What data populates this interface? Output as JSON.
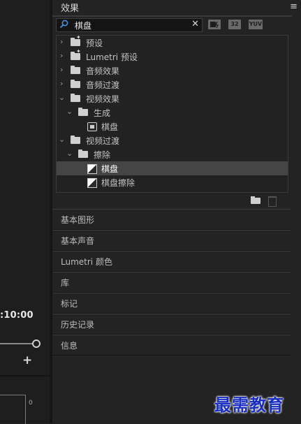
{
  "timeline": {
    "timecode": ":10:00",
    "add_label": "+",
    "meter_zero": "0"
  },
  "effects_panel": {
    "title": "效果",
    "menu_glyph": "≡",
    "search": {
      "value": "棋盘",
      "clear_glyph": "✕"
    },
    "filter_badges": [
      "32",
      "YUV"
    ],
    "tree": [
      {
        "label": "预设",
        "expanded": false,
        "depth": 0,
        "icon": "folder-star-icon"
      },
      {
        "label": "Lumetri 预设",
        "expanded": false,
        "depth": 0,
        "icon": "folder-star-icon"
      },
      {
        "label": "音频效果",
        "expanded": false,
        "depth": 0,
        "icon": "folder-icon"
      },
      {
        "label": "音频过渡",
        "expanded": false,
        "depth": 0,
        "icon": "folder-icon"
      },
      {
        "label": "视频效果",
        "expanded": true,
        "depth": 0,
        "icon": "folder-icon"
      },
      {
        "label": "生成",
        "expanded": true,
        "depth": 1,
        "icon": "folder-icon"
      },
      {
        "label": "棋盘",
        "depth": 2,
        "icon": "video-effect-icon"
      },
      {
        "label": "视频过渡",
        "expanded": true,
        "depth": 0,
        "icon": "folder-icon"
      },
      {
        "label": "擦除",
        "expanded": true,
        "depth": 1,
        "icon": "folder-icon"
      },
      {
        "label": "棋盘",
        "depth": 2,
        "icon": "transition-icon",
        "selected": true
      },
      {
        "label": "棋盘擦除",
        "depth": 2,
        "icon": "transition-icon"
      }
    ]
  },
  "sections": [
    "基本图形",
    "基本声音",
    "Lumetri 颜色",
    "库",
    "标记",
    "历史记录",
    "信息"
  ],
  "watermark": "最需教育",
  "colors": {
    "panel_bg": "#232323",
    "selection": "#454545",
    "search_icon": "#4a8fe0",
    "watermark": "#1a2fc0"
  }
}
